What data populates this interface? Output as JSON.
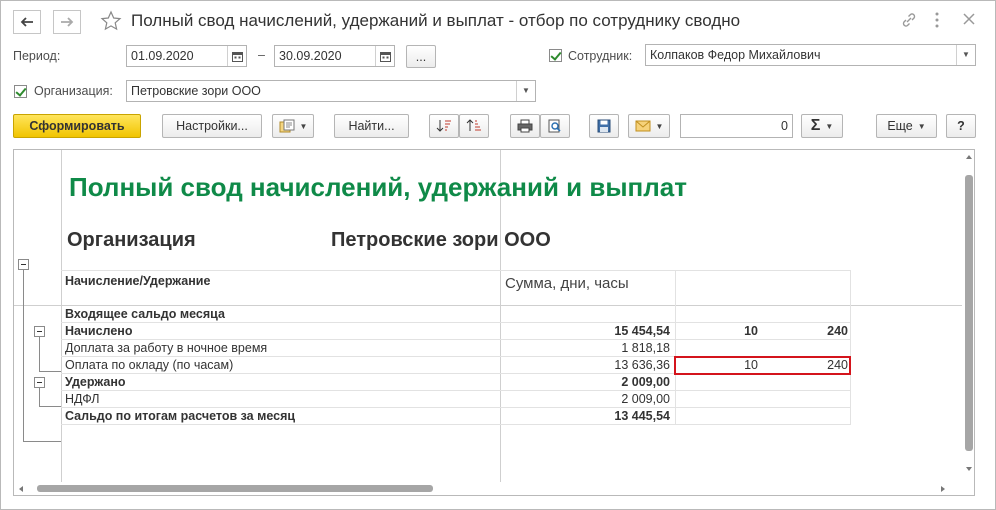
{
  "window": {
    "title": "Полный свод начислений, удержаний и выплат - отбор по сотруднику сводно"
  },
  "form": {
    "period_label": "Период:",
    "date_from": "01.09.2020",
    "dash": "–",
    "date_to": "30.09.2020",
    "ellipsis": "...",
    "employee_label": "Сотрудник:",
    "employee_value": "Колпаков Федор Михайлович",
    "org_label": "Организация:",
    "org_value": "Петровские зори ООО"
  },
  "toolbar": {
    "generate": "Сформировать",
    "settings": "Настройки...",
    "find": "Найти...",
    "sum_value": "0",
    "more": "Еще",
    "help": "?"
  },
  "report": {
    "title": "Полный свод начислений, удержаний и выплат",
    "org_label": "Организация",
    "org_value": "Петровские зори ООО",
    "col_item": "Начисление/Удержание",
    "col_values": "Сумма, дни, часы",
    "rows": [
      {
        "label": "Входящее сальдо месяца",
        "sum": "",
        "days": "",
        "hours": ""
      },
      {
        "label": "Начислено",
        "sum": "15 454,54",
        "days": "10",
        "hours": "240"
      },
      {
        "label": "Доплата за работу в ночное время",
        "sum": "1 818,18",
        "days": "",
        "hours": ""
      },
      {
        "label": "Оплата по окладу (по часам)",
        "sum": "13 636,36",
        "days": "10",
        "hours": "240"
      },
      {
        "label": "Удержано",
        "sum": "2 009,00",
        "days": "",
        "hours": ""
      },
      {
        "label": "НДФЛ",
        "sum": "2 009,00",
        "days": "",
        "hours": ""
      },
      {
        "label": "Сальдо по итогам расчетов за месяц",
        "sum": "13 445,54",
        "days": "",
        "hours": ""
      }
    ]
  },
  "icons": [
    "back-arrow-icon",
    "forward-arrow-icon",
    "star-icon",
    "link-icon",
    "kebab-menu-icon",
    "close-icon",
    "calendar-icon",
    "dropdown-icon",
    "variant-icon",
    "sort-desc-icon",
    "sort-asc-icon",
    "print-icon",
    "preview-icon",
    "save-icon",
    "mail-icon",
    "sum-icon"
  ]
}
